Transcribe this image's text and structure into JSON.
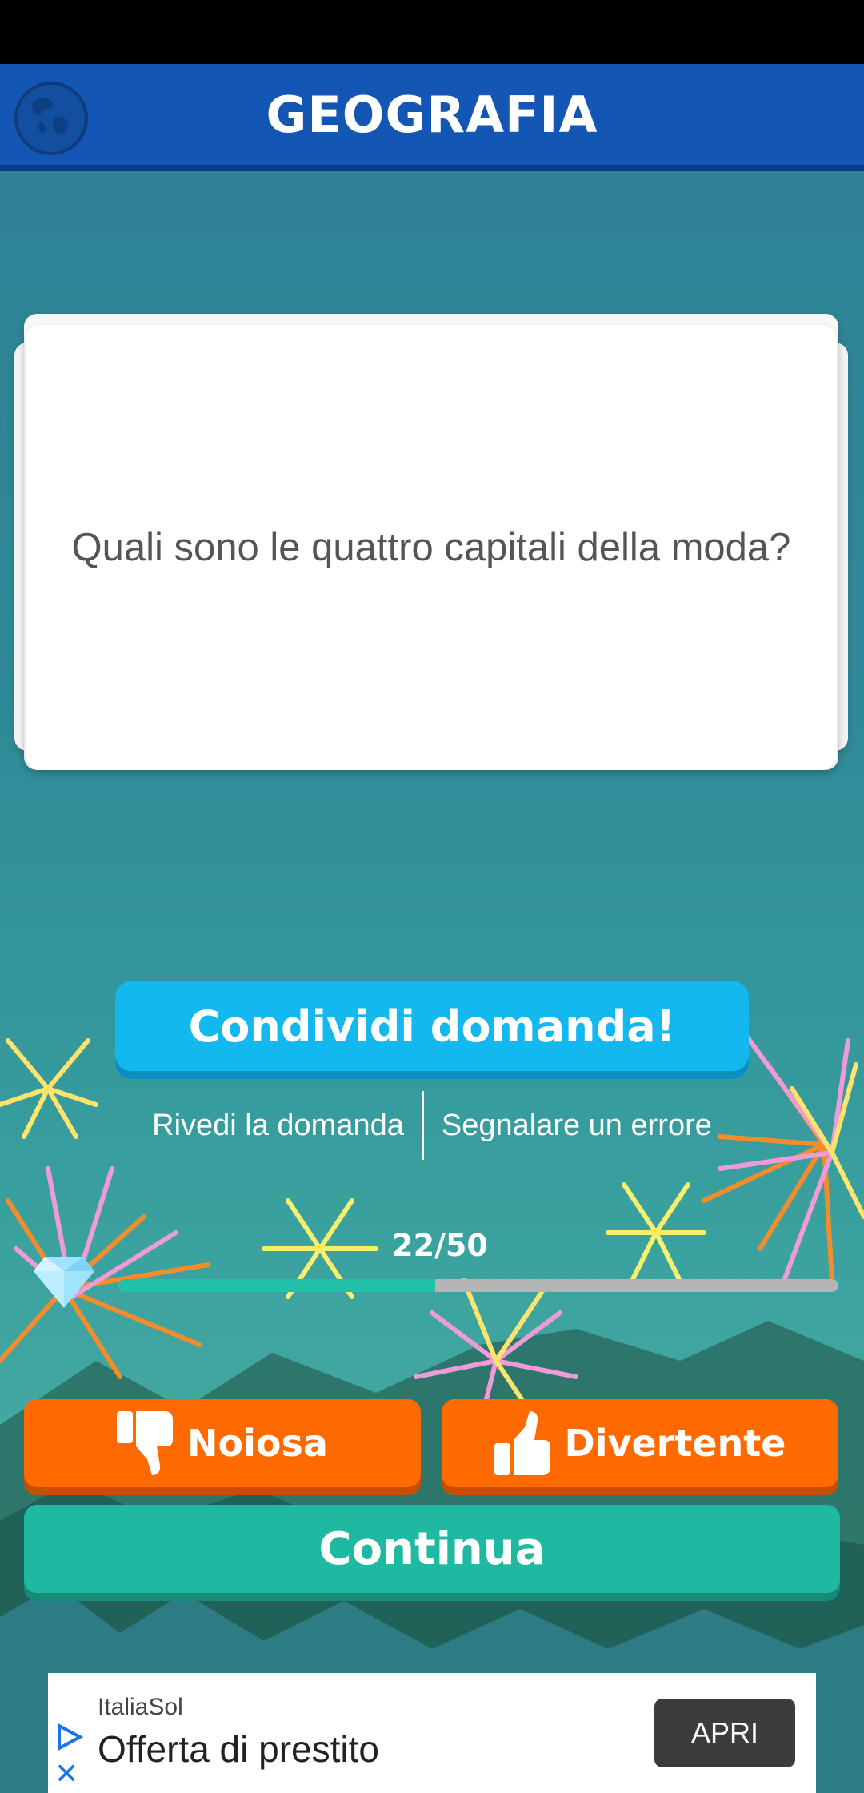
{
  "header": {
    "title": "GEOGRAFIA",
    "category_icon": "globe-icon",
    "color": "#1356b3"
  },
  "question": {
    "text": "Quali sono le quattro capitali della moda?"
  },
  "actions": {
    "share_label": "Condividi domanda!",
    "review_label": "Rivedi la domanda",
    "report_label": "Segnalare un errore"
  },
  "progress": {
    "label": "22/50",
    "current": 22,
    "total": 50,
    "fraction": 0.44,
    "icon": "diamond-icon"
  },
  "vote": {
    "boring_label": "Noiosa",
    "boring_icon": "thumbs-down-icon",
    "fun_label": "Divertente",
    "fun_icon": "thumbs-up-icon"
  },
  "continue_label": "Continua",
  "ad": {
    "brand": "ItaliaSol",
    "title": "Offerta di prestito",
    "cta": "APRI"
  },
  "colors": {
    "share": "#13b8ef",
    "vote": "#ff6a00",
    "continue": "#1fb9a1",
    "progress_fill": "#21c1a8"
  }
}
